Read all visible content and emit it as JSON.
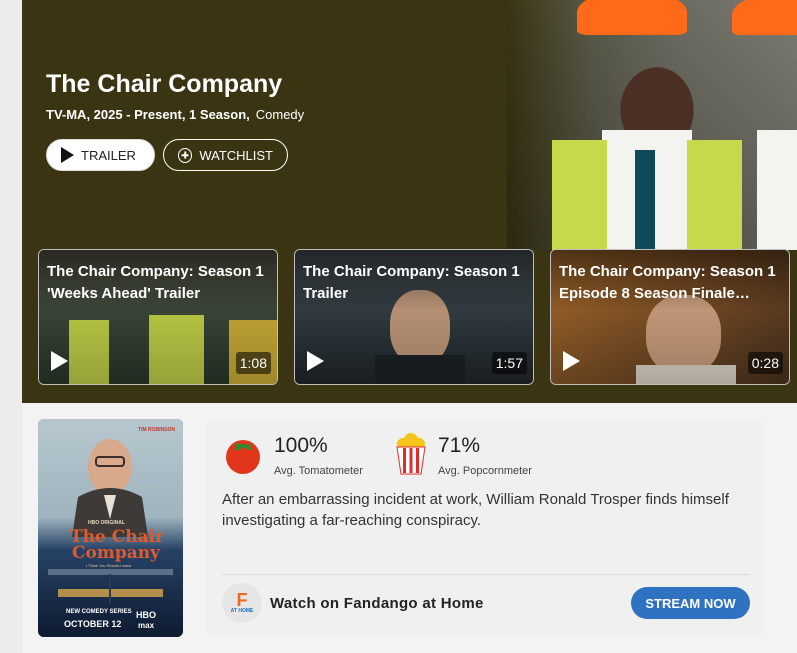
{
  "show": {
    "title": "The Chair Company",
    "meta": "TV-MA, 2025 - Present, 1 Season,",
    "genre": "Comedy"
  },
  "buttons": {
    "trailer": "TRAILER",
    "watchlist": "WATCHLIST"
  },
  "videos": [
    {
      "title": "The Chair Company: Season 1 'Weeks Ahead' Trailer",
      "duration": "1:08"
    },
    {
      "title": "The Chair Company: Season 1 Trailer",
      "duration": "1:57"
    },
    {
      "title": "The Chair Company: Season 1 Episode 8 Season Finale…",
      "duration": "0:28"
    }
  ],
  "poster": {
    "actor": "TIM ROBINSON",
    "network_line": "HBO ORIGINAL",
    "title_line1": "The Chair",
    "title_line2": "Company",
    "tagline": "I Think You Should Leave",
    "series": "NEW COMEDY SERIES",
    "date": "OCTOBER 12",
    "brand1": "HBO",
    "brand2": "max"
  },
  "scores": {
    "tomatometer": {
      "value": "100%",
      "label": "Avg. Tomatometer"
    },
    "popcornmeter": {
      "value": "71%",
      "label": "Avg. Popcornmeter"
    }
  },
  "synopsis": "After an embarrassing incident at work, William Ronald Trosper finds himself investigating a far-reaching conspiracy.",
  "watch": {
    "logo_mark": "F",
    "logo_sub": "AT HOME",
    "text": "Watch on Fandango at Home",
    "button": "STREAM NOW"
  },
  "colors": {
    "hero_bg": "#3a3413",
    "stream_button": "#3072c2",
    "fandango_orange": "#f26a21"
  }
}
